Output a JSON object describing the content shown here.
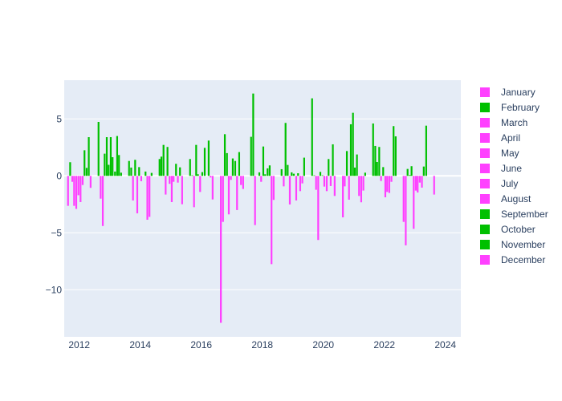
{
  "chart_data": {
    "type": "bar",
    "title": "",
    "xlabel": "",
    "ylabel": "",
    "xlim": [
      2011.55,
      2024.5
    ],
    "ylim": [
      -14,
      8.4
    ],
    "x_ticks": [
      2012,
      2014,
      2016,
      2018,
      2020,
      2022,
      2024
    ],
    "y_ticks": [
      5,
      0,
      -5,
      -10
    ],
    "y_tick_labels": [
      "5",
      "0",
      "−5",
      "−10"
    ],
    "grid": true,
    "legend_position": "right",
    "colors": {
      "positive": "#00c000",
      "negative": "#ff40ff"
    },
    "legend": [
      {
        "name": "January",
        "color": "#ff40ff"
      },
      {
        "name": "February",
        "color": "#00c000"
      },
      {
        "name": "March",
        "color": "#ff40ff"
      },
      {
        "name": "April",
        "color": "#ff40ff"
      },
      {
        "name": "May",
        "color": "#ff40ff"
      },
      {
        "name": "June",
        "color": "#ff40ff"
      },
      {
        "name": "July",
        "color": "#ff40ff"
      },
      {
        "name": "August",
        "color": "#ff40ff"
      },
      {
        "name": "September",
        "color": "#00c000"
      },
      {
        "name": "October",
        "color": "#00c000"
      },
      {
        "name": "November",
        "color": "#00c000"
      },
      {
        "name": "December",
        "color": "#ff40ff"
      }
    ],
    "points": [
      [
        2011.63,
        -2.63
      ],
      [
        2011.7,
        1.2
      ],
      [
        2011.77,
        -0.52
      ],
      [
        2011.83,
        -2.63
      ],
      [
        2011.9,
        -2.9
      ],
      [
        2011.97,
        -1.7
      ],
      [
        2012.04,
        -2.3
      ],
      [
        2012.11,
        -0.8
      ],
      [
        2012.17,
        2.25
      ],
      [
        2012.24,
        0.7
      ],
      [
        2012.31,
        3.4
      ],
      [
        2012.37,
        -1.05
      ],
      [
        2012.63,
        4.74
      ],
      [
        2012.7,
        -2.0
      ],
      [
        2012.77,
        -4.4
      ],
      [
        2012.83,
        1.95
      ],
      [
        2012.9,
        3.4
      ],
      [
        2012.96,
        0.97
      ],
      [
        2013.03,
        3.4
      ],
      [
        2013.09,
        1.64
      ],
      [
        2013.17,
        0.38
      ],
      [
        2013.24,
        3.5
      ],
      [
        2013.3,
        1.83
      ],
      [
        2013.37,
        0.28
      ],
      [
        2013.63,
        1.31
      ],
      [
        2013.7,
        0.73
      ],
      [
        2013.76,
        -2.16
      ],
      [
        2013.83,
        1.41
      ],
      [
        2013.9,
        -3.29
      ],
      [
        2013.96,
        0.77
      ],
      [
        2014.03,
        -0.47
      ],
      [
        2014.17,
        0.38
      ],
      [
        2014.23,
        -3.85
      ],
      [
        2014.3,
        -3.6
      ],
      [
        2014.37,
        0.26
      ],
      [
        2014.63,
        1.48
      ],
      [
        2014.69,
        1.69
      ],
      [
        2014.76,
        2.72
      ],
      [
        2014.83,
        -1.64
      ],
      [
        2014.89,
        2.54
      ],
      [
        2014.96,
        -0.7
      ],
      [
        2015.03,
        -2.3
      ],
      [
        2015.09,
        -0.52
      ],
      [
        2015.17,
        1.06
      ],
      [
        2015.23,
        -0.59
      ],
      [
        2015.3,
        0.75
      ],
      [
        2015.37,
        -2.49
      ],
      [
        2015.63,
        1.48
      ],
      [
        2015.7,
        0.05
      ],
      [
        2015.76,
        -2.75
      ],
      [
        2015.83,
        2.72
      ],
      [
        2015.89,
        0.14
      ],
      [
        2015.96,
        -1.41
      ],
      [
        2016.03,
        0.33
      ],
      [
        2016.11,
        2.46
      ],
      [
        2016.24,
        3.1
      ],
      [
        2016.3,
        -0.14
      ],
      [
        2016.37,
        -2.07
      ],
      [
        2016.64,
        -12.9
      ],
      [
        2016.71,
        -4.04
      ],
      [
        2016.77,
        3.66
      ],
      [
        2016.84,
        2.0
      ],
      [
        2016.9,
        -3.38
      ],
      [
        2016.97,
        -0.35
      ],
      [
        2017.03,
        1.53
      ],
      [
        2017.11,
        1.31
      ],
      [
        2017.17,
        -3.0
      ],
      [
        2017.24,
        2.09
      ],
      [
        2017.3,
        -0.8
      ],
      [
        2017.37,
        -1.15
      ],
      [
        2017.63,
        3.43
      ],
      [
        2017.7,
        7.23
      ],
      [
        2017.76,
        -4.32
      ],
      [
        2017.9,
        0.31
      ],
      [
        2017.96,
        -0.52
      ],
      [
        2018.03,
        2.58
      ],
      [
        2018.09,
        0.14
      ],
      [
        2018.17,
        0.66
      ],
      [
        2018.24,
        0.92
      ],
      [
        2018.3,
        -7.75
      ],
      [
        2018.37,
        -2.11
      ],
      [
        2018.63,
        0.59
      ],
      [
        2018.7,
        -0.92
      ],
      [
        2018.76,
        4.65
      ],
      [
        2018.83,
        0.96
      ],
      [
        2018.9,
        -2.51
      ],
      [
        2018.96,
        0.31
      ],
      [
        2019.03,
        0.19
      ],
      [
        2019.11,
        -2.16
      ],
      [
        2019.17,
        0.23
      ],
      [
        2019.24,
        -1.34
      ],
      [
        2019.31,
        -0.66
      ],
      [
        2019.37,
        1.6
      ],
      [
        2019.63,
        6.81
      ],
      [
        2019.7,
        0.05
      ],
      [
        2019.76,
        -1.22
      ],
      [
        2019.83,
        -5.63
      ],
      [
        2019.9,
        0.35
      ],
      [
        2019.97,
        0.05
      ],
      [
        2020.03,
        -0.94
      ],
      [
        2020.11,
        -1.34
      ],
      [
        2020.17,
        1.48
      ],
      [
        2020.24,
        -0.89
      ],
      [
        2020.31,
        2.77
      ],
      [
        2020.37,
        -1.76
      ],
      [
        2020.64,
        -3.64
      ],
      [
        2020.7,
        -0.92
      ],
      [
        2020.77,
        2.18
      ],
      [
        2020.84,
        -2.09
      ],
      [
        2020.9,
        4.53
      ],
      [
        2020.97,
        5.54
      ],
      [
        2021.03,
        0.73
      ],
      [
        2021.1,
        1.88
      ],
      [
        2021.17,
        -1.76
      ],
      [
        2021.24,
        -2.32
      ],
      [
        2021.31,
        -1.29
      ],
      [
        2021.37,
        0.28
      ],
      [
        2021.63,
        4.6
      ],
      [
        2021.7,
        2.63
      ],
      [
        2021.76,
        1.22
      ],
      [
        2021.83,
        2.54
      ],
      [
        2021.89,
        -0.45
      ],
      [
        2021.96,
        0.77
      ],
      [
        2022.03,
        -1.88
      ],
      [
        2022.09,
        -1.41
      ],
      [
        2022.16,
        -1.5
      ],
      [
        2022.23,
        -0.52
      ],
      [
        2022.3,
        4.37
      ],
      [
        2022.37,
        3.47
      ],
      [
        2022.63,
        -4.04
      ],
      [
        2022.7,
        -6.1
      ],
      [
        2022.76,
        0.61
      ],
      [
        2022.83,
        0.07
      ],
      [
        2022.89,
        0.85
      ],
      [
        2022.96,
        -4.65
      ],
      [
        2023.03,
        -1.29
      ],
      [
        2023.09,
        -1.46
      ],
      [
        2023.16,
        -0.59
      ],
      [
        2023.23,
        -1.03
      ],
      [
        2023.29,
        0.82
      ],
      [
        2023.37,
        4.41
      ],
      [
        2023.63,
        -1.64
      ]
    ]
  }
}
